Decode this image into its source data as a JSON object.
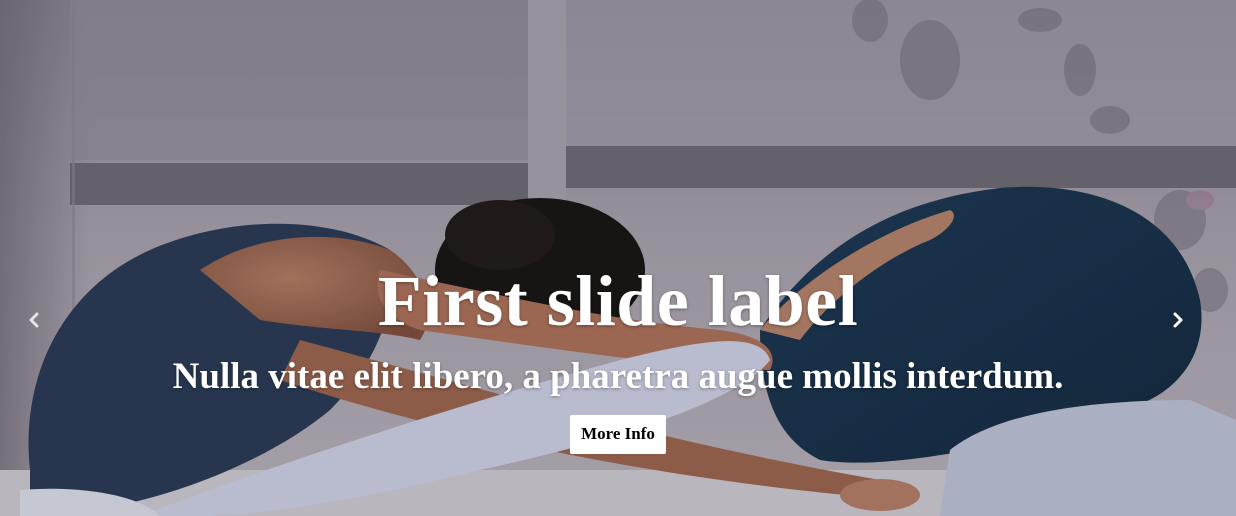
{
  "slide": {
    "title": "First slide label",
    "subtitle": "Nulla vitae elit libero, a pharetra augue mollis interdum.",
    "button_label": "More Info"
  },
  "controls": {
    "prev_icon": "chevron-left-icon",
    "next_icon": "chevron-right-icon"
  },
  "colors": {
    "caption_text": "#ffffff",
    "button_bg": "#ffffff",
    "button_text": "#000000",
    "wall": "#a9a2ad",
    "top_shirt": "#2a3a52",
    "leggings": "#1c3450"
  }
}
